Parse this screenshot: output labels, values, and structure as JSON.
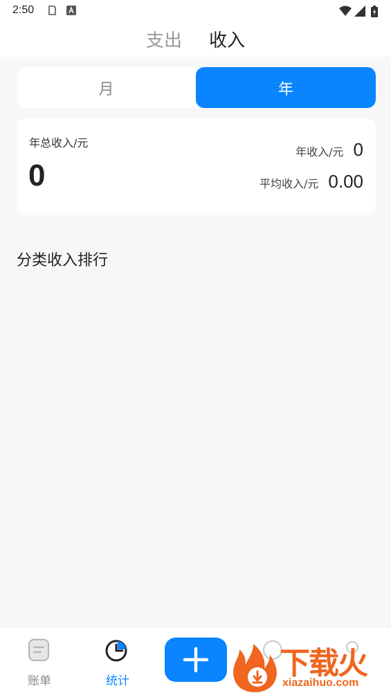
{
  "status_bar": {
    "time": "2:50"
  },
  "header_tabs": {
    "expense": "支出",
    "income": "收入",
    "active": "income"
  },
  "period_toggle": {
    "month": "月",
    "year": "年",
    "active": "year"
  },
  "summary": {
    "total_label": "年总收入/元",
    "total_value": "0",
    "year_label": "年收入/元",
    "year_value": "0",
    "avg_label": "平均收入/元",
    "avg_value": "0.00"
  },
  "ranking": {
    "title": "分类收入排行"
  },
  "bottom_nav": {
    "bills_label": "账单",
    "stats_label": "统计",
    "active": "stats"
  },
  "watermark": {
    "cn": "下载火",
    "en": "xiazaihuo.com"
  },
  "colors": {
    "accent": "#0a84ff",
    "background": "#f7f7f7",
    "watermark": "#f0651f"
  }
}
